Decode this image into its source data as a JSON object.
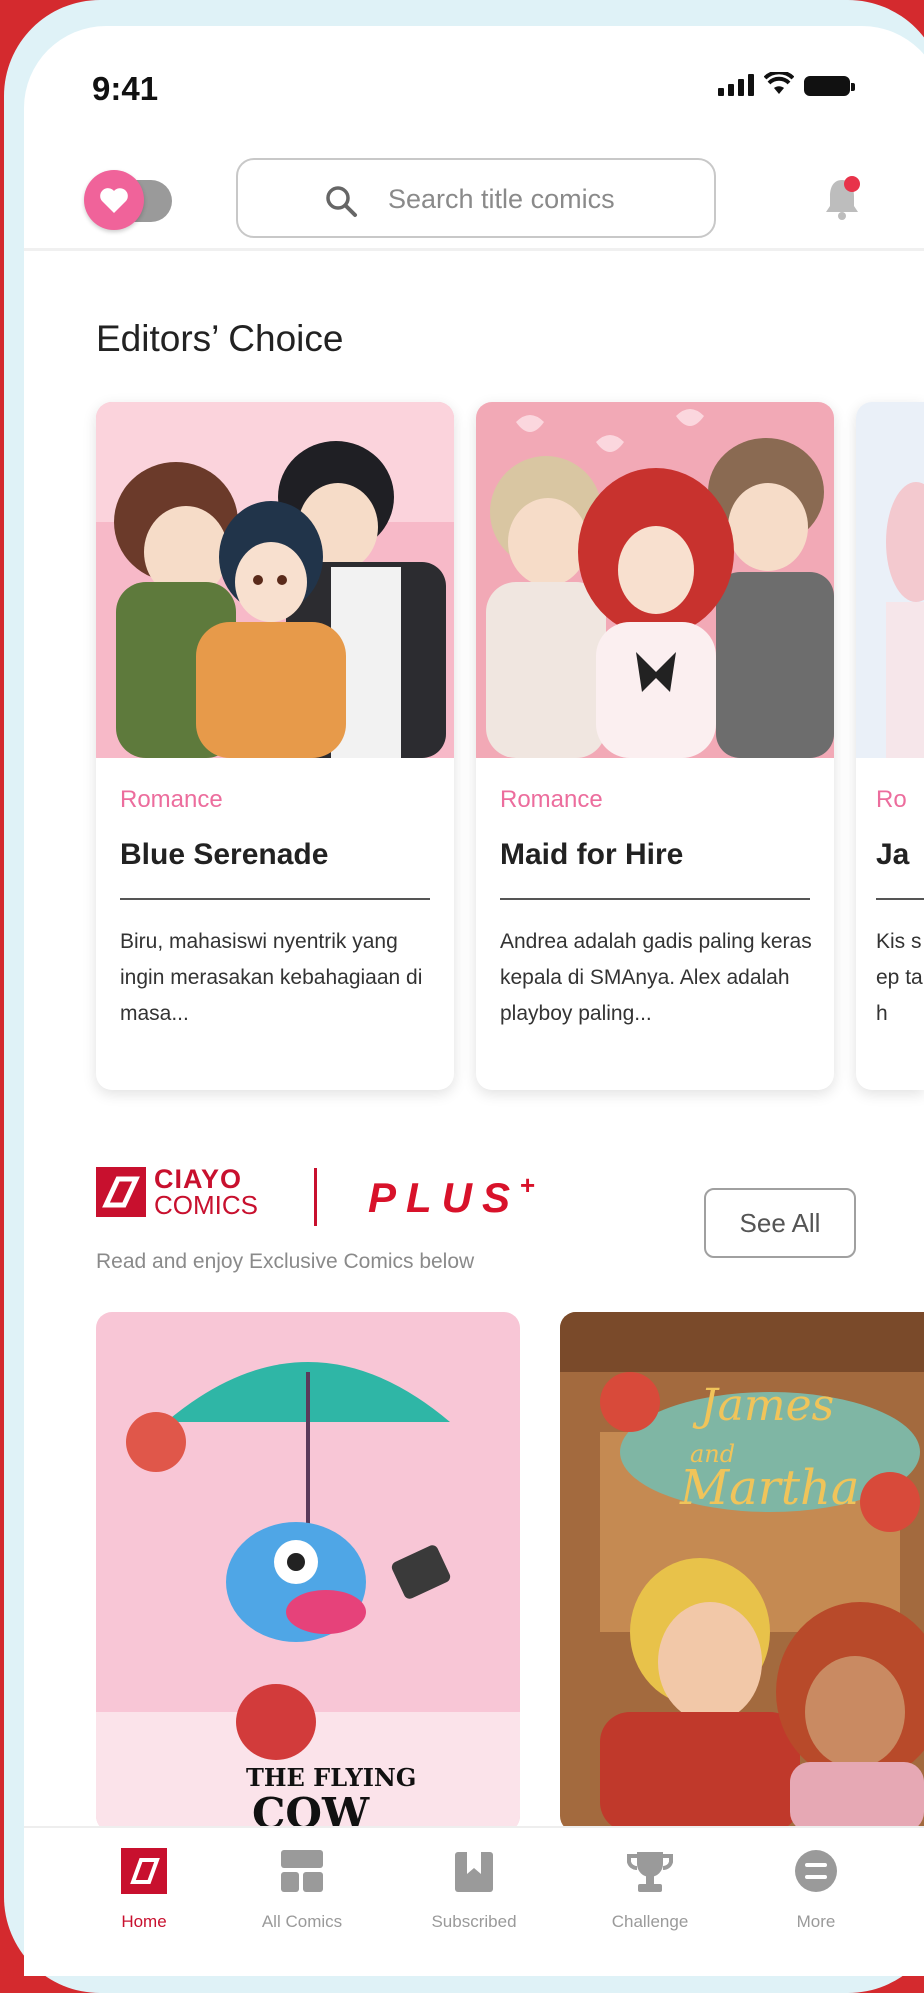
{
  "status_bar": {
    "time": "9:41"
  },
  "header": {
    "search_placeholder": "Search title comics"
  },
  "editors_choice": {
    "title": "Editors’ Choice",
    "cards": [
      {
        "genre": "Romance",
        "title": "Blue Serenade",
        "description": "Biru, mahasiswi nyentrik yang ingin merasakan kebahagiaan di masa..."
      },
      {
        "genre": "Romance",
        "title": "Maid for Hire",
        "description": "Andrea adalah gadis paling keras kepala di SMAnya. Alex adalah playboy paling..."
      },
      {
        "genre": "Ro",
        "title": "Ja",
        "description": "Kis sep tah"
      }
    ]
  },
  "plus_section": {
    "logo_line1": "CIAYO",
    "logo_line2": "COMICS",
    "plus_label": "PLUS",
    "plus_mark": "+",
    "subtitle": "Read and enjoy Exclusive Comics below",
    "see_all": "See All",
    "comics": [
      {
        "cover_text_1": "THE FLYING",
        "cover_text_2": "COW"
      },
      {
        "cover_text_1": "James",
        "cover_text_2": "and",
        "cover_text_3": "Martha"
      }
    ]
  },
  "bottom_nav": [
    {
      "label": "Home",
      "icon": "home-icon",
      "active": true
    },
    {
      "label": "All Comics",
      "icon": "all-comics-icon",
      "active": false
    },
    {
      "label": "Subscribed",
      "icon": "subscribed-icon",
      "active": false
    },
    {
      "label": "Challenge",
      "icon": "trophy-icon",
      "active": false
    },
    {
      "label": "More",
      "icon": "more-icon",
      "active": false
    }
  ],
  "colors": {
    "brand_red": "#c8102e",
    "pink": "#f0639a",
    "genre_pink": "#ec6d9d"
  }
}
